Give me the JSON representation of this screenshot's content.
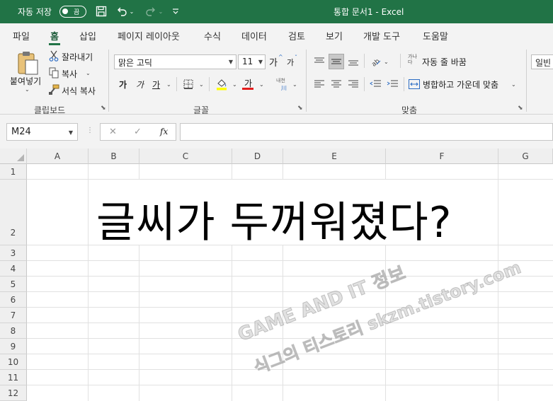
{
  "titlebar": {
    "autosave_label": "자동 저장",
    "autosave_state": "끔",
    "document_title": "통합 문서1  -  Excel"
  },
  "menu": {
    "tabs": [
      "파일",
      "홈",
      "삽입",
      "페이지 레이아웃",
      "수식",
      "데이터",
      "검토",
      "보기",
      "개발 도구",
      "도움말"
    ],
    "active_tab": "홈"
  },
  "ribbon": {
    "clipboard": {
      "paste_label": "붙여넣기",
      "cut_label": "잘라내기",
      "copy_label": "복사",
      "format_painter_label": "서식 복사",
      "group_label": "클립보드"
    },
    "font": {
      "font_name": "맑은 고딕",
      "font_size": "11",
      "grow_label": "가",
      "shrink_label": "가",
      "bold_label": "가",
      "italic_label": "가",
      "underline_label": "가",
      "font_color_label": "가",
      "phonetic_top": "내천",
      "phonetic_bottom": "川",
      "group_label": "글꼴"
    },
    "alignment": {
      "wrap_icon_text": "가나\n다",
      "wrap_text_label": "자동 줄 바꿈",
      "merge_center_label": "병합하고 가운데 맞춤",
      "group_label": "맞춤"
    },
    "number": {
      "format_value": "일빈"
    }
  },
  "formula_bar": {
    "name_box": "M24",
    "cancel_icon": "✕",
    "enter_icon": "✓",
    "fx_label": "fx",
    "formula_value": ""
  },
  "sheet": {
    "columns": [
      "A",
      "B",
      "C",
      "D",
      "E",
      "F",
      "G"
    ],
    "rows": [
      "1",
      "2",
      "3",
      "4",
      "5",
      "6",
      "7",
      "8",
      "9",
      "10",
      "11",
      "12"
    ],
    "cell_text": "글씨가 두꺼워졌다?"
  },
  "watermark": {
    "line1": "GAME AND IT 정보",
    "line2": "식그의 티스토리 skzm.tistory.com"
  },
  "colors": {
    "accent": "#217346",
    "font_color_bar": "#e31c1c",
    "fill_color_bar": "#ffff00"
  }
}
